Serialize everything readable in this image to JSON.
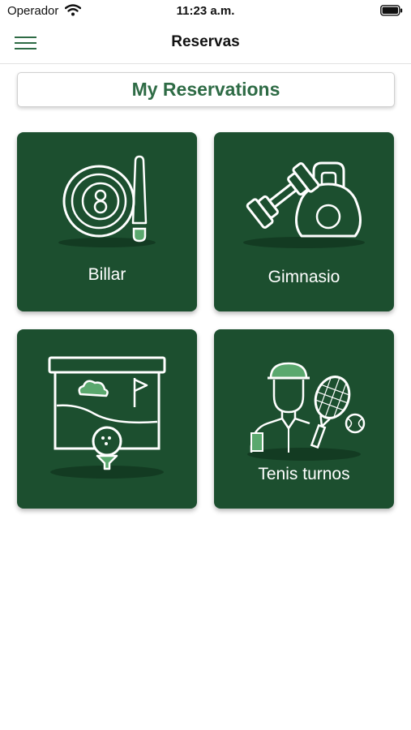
{
  "status_bar": {
    "carrier": "Operador",
    "time": "11:23 a.m."
  },
  "nav": {
    "title": "Reservas"
  },
  "my_reservations_label": "My Reservations",
  "tiles": [
    {
      "label": "Billar",
      "icon": "billiards-icon"
    },
    {
      "label": "Gimnasio",
      "icon": "gym-icon"
    },
    {
      "label": "",
      "icon": "golf-icon"
    },
    {
      "label": "Tenis turnos",
      "icon": "tennis-icon"
    }
  ],
  "colors": {
    "tile_bg": "#1c4f2f",
    "accent": "#2e6b45",
    "icon_accent": "#5aa86e"
  }
}
